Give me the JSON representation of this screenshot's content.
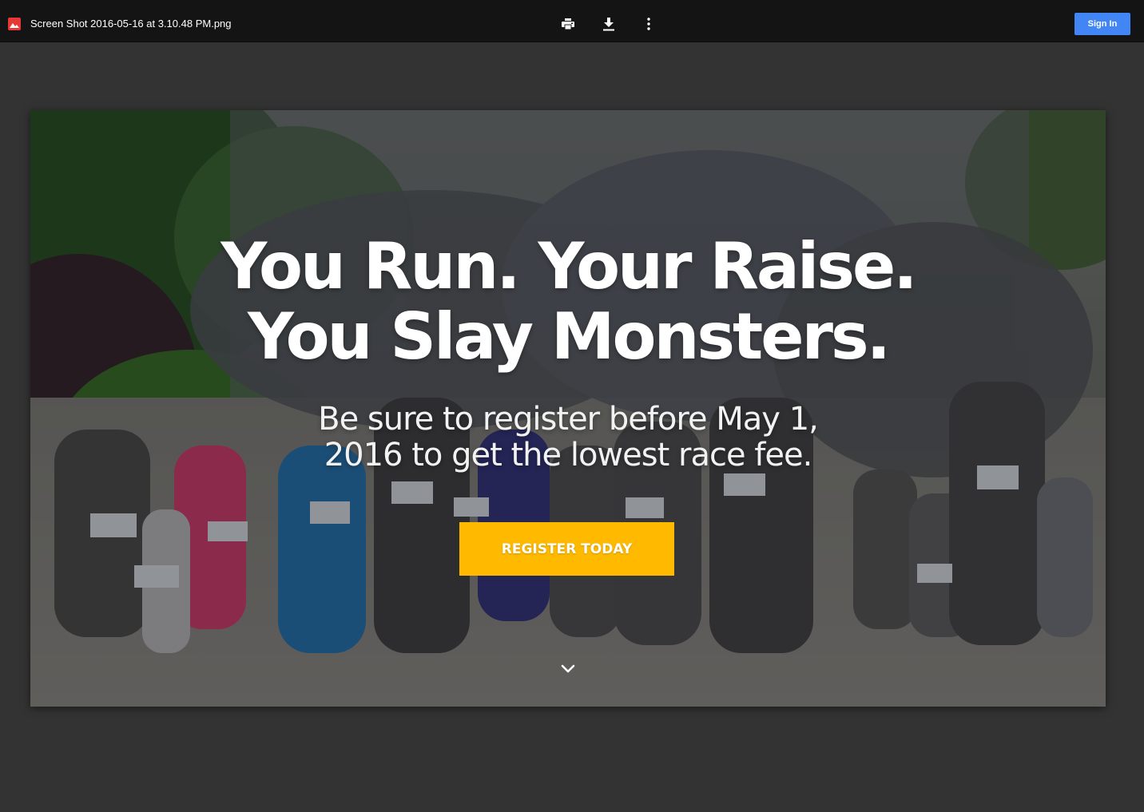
{
  "topbar": {
    "file_name": "Screen Shot 2016-05-16 at 3.10.48 PM.png",
    "file_icon": "image-file-icon",
    "file_icon_color": "#e53935",
    "tools": [
      {
        "name": "print",
        "icon": "print-icon"
      },
      {
        "name": "download",
        "icon": "download-icon"
      },
      {
        "name": "more",
        "icon": "more-vert-icon"
      }
    ],
    "sign_in_label": "Sign In",
    "sign_in_color": "#4285f4"
  },
  "hero": {
    "headline_line1": "You Run. Your Raise.",
    "headline_line2": "You Slay Monsters.",
    "subhead_line1": "Be sure to register before May 1,",
    "subhead_line2": "2016 to get the lowest race fee.",
    "cta_label": "REGISTER TODAY",
    "cta_color": "#ffba00",
    "scroll_icon": "chevron-down-icon"
  }
}
